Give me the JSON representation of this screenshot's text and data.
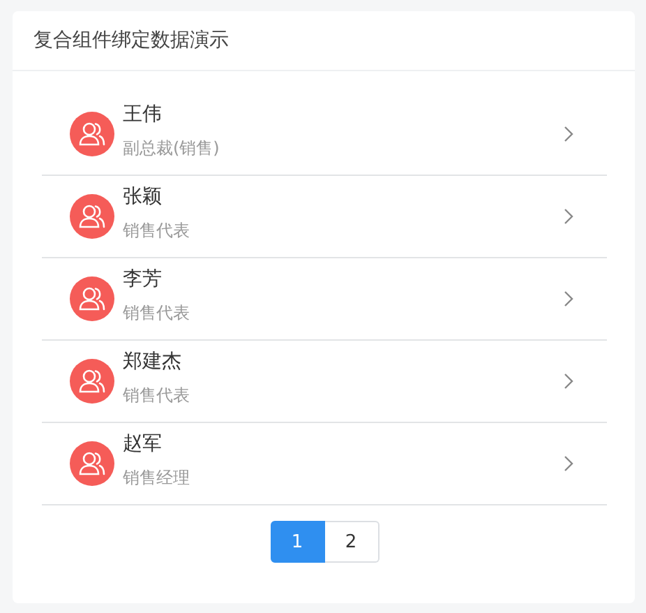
{
  "title": "复合组件绑定数据演示",
  "contacts": [
    {
      "name": "王伟",
      "role": "副总裁(销售)"
    },
    {
      "name": "张颖",
      "role": "销售代表"
    },
    {
      "name": "李芳",
      "role": "销售代表"
    },
    {
      "name": "郑建杰",
      "role": "销售代表"
    },
    {
      "name": "赵军",
      "role": "销售经理"
    }
  ],
  "pagination": [
    {
      "label": "1",
      "selected": true
    },
    {
      "label": "2",
      "selected": false
    }
  ]
}
